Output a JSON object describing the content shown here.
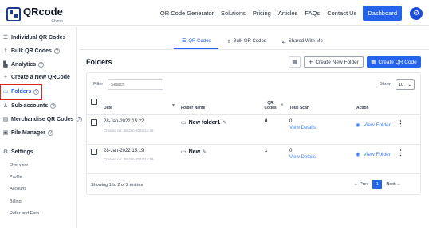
{
  "brand": {
    "name": "QRcode",
    "sub": "Chimp"
  },
  "nav": {
    "items": [
      "QR Code Generator",
      "Solutions",
      "Pricing",
      "Articles",
      "FAQs",
      "Contact Us"
    ],
    "dashboard": "Dashboard"
  },
  "sidebar": {
    "items": [
      {
        "label": "Individual QR Codes",
        "icon": "list-icon"
      },
      {
        "label": "Bulk QR Codes",
        "icon": "upload-icon"
      },
      {
        "label": "Analytics",
        "icon": "bar-chart-icon"
      },
      {
        "label": "Create a New QRCode",
        "icon": "plus-icon"
      },
      {
        "label": "Folders",
        "icon": "folder-icon"
      },
      {
        "label": "Sub-accounts",
        "icon": "users-icon"
      },
      {
        "label": "Merchandise QR Codes",
        "icon": "merch-icon"
      },
      {
        "label": "File Manager",
        "icon": "file-icon"
      },
      {
        "label": "Settings",
        "icon": "gear-icon"
      }
    ],
    "settings_sub": [
      "Overview",
      "Profile",
      "Account",
      "Billing",
      "Refer and Earn"
    ]
  },
  "tabs": [
    {
      "label": "QR Codes",
      "active": true
    },
    {
      "label": "Bulk QR Codes",
      "active": false
    },
    {
      "label": "Shared With Me",
      "active": false
    }
  ],
  "page": {
    "title": "Folders",
    "new_folder": "Create New Folder",
    "create_qr": "Create QR Code"
  },
  "filter": {
    "label": "Filter",
    "placeholder": "Search"
  },
  "show": {
    "label": "Show",
    "value": "10"
  },
  "table": {
    "headers": {
      "date": "Date",
      "folder": "Folder Name",
      "qr_codes": "QR Codes",
      "total_scan": "Total Scan",
      "action": "Action"
    },
    "rows": [
      {
        "date": "28-Jan-2022 15:22",
        "created": "Created on: 28-Jan-2022 14:45",
        "folder": "New folder1",
        "qr": "0",
        "scan": "0",
        "details": "View Details",
        "view": "View Folder"
      },
      {
        "date": "28-Jan-2022 15:19",
        "created": "Created on: 28-Jan-2022 14:56",
        "folder": "New",
        "qr": "1",
        "scan": "0",
        "details": "View Details",
        "view": "View Folder"
      }
    ]
  },
  "footer": {
    "showing": "Showing 1 to 2 of 2 entries",
    "prev": "Prev",
    "page": "1",
    "next": "Next"
  },
  "colors": {
    "accent": "#2563eb",
    "highlight_box": "#dc2626"
  }
}
